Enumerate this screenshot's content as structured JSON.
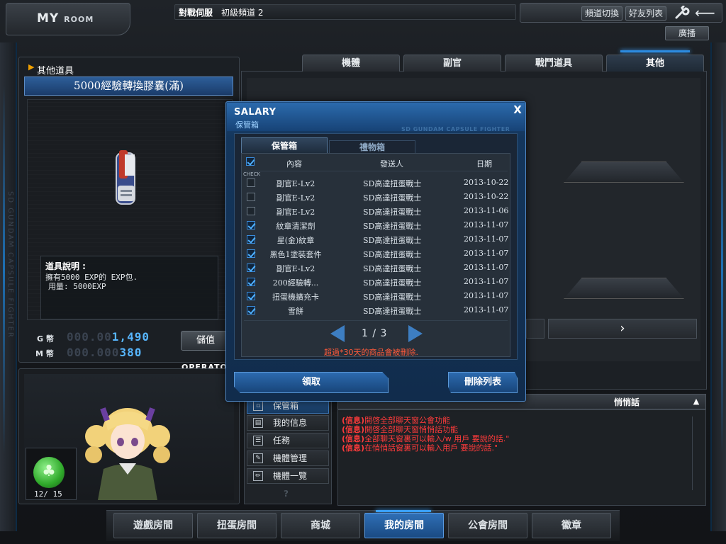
{
  "header": {
    "logo": "MY",
    "logo_small": "ROOM",
    "server": "對戰伺服",
    "channel": "初級頻道 2",
    "channel_switch": "頻道切換",
    "friend_list": "好友列表",
    "broadcast": "廣播"
  },
  "side_text": "SD GUNDAM CAPSULE FIGHTER",
  "left_panel": {
    "section_title": "其他道具",
    "item_name": "5000經驗轉換膠囊(滿)",
    "desc_title": "道具說明 :",
    "desc_line1": "擁有5000 EXP的 EXP包.",
    "desc_line2": "用量: 5000EXP",
    "g_label": "G 幣",
    "m_label": "M 幣",
    "g_dim": "000.00",
    "g_lit": "1,490",
    "m_dim": "000.000",
    "m_lit": "380",
    "recharge": "儲值",
    "operator_label": "OPERATO",
    "stamina": "12/ 15"
  },
  "tabs": [
    "機體",
    "副官",
    "戰鬥道具",
    "其他"
  ],
  "modal": {
    "title": "SALARY",
    "subtitle": "保管箱",
    "watermark": "SD GUNDAM CAPSULE FIGHTER",
    "close": "X",
    "tab_storage": "保管箱",
    "tab_gift": "禮物箱",
    "col_content": "內容",
    "col_sender": "發送人",
    "col_date": "日期",
    "check_label": "CHECK",
    "rows": [
      {
        "content": "副官E-Lv2",
        "sender": "SD高達扭蛋戰士",
        "date": "2013-10-22",
        "checked": false
      },
      {
        "content": "副官E-Lv2",
        "sender": "SD高達扭蛋戰士",
        "date": "2013-10-22",
        "checked": false
      },
      {
        "content": "副官E-Lv2",
        "sender": "SD高達扭蛋戰士",
        "date": "2013-11-06",
        "checked": false
      },
      {
        "content": "紋章清潔劑",
        "sender": "SD高達扭蛋戰士",
        "date": "2013-11-07",
        "checked": true
      },
      {
        "content": "星(金)紋章",
        "sender": "SD高達扭蛋戰士",
        "date": "2013-11-07",
        "checked": true
      },
      {
        "content": "黑色1塗裝套件",
        "sender": "SD高達扭蛋戰士",
        "date": "2013-11-07",
        "checked": true
      },
      {
        "content": "副官E-Lv2",
        "sender": "SD高達扭蛋戰士",
        "date": "2013-11-07",
        "checked": true
      },
      {
        "content": "200經驗轉...",
        "sender": "SD高達扭蛋戰士",
        "date": "2013-11-07",
        "checked": true
      },
      {
        "content": "扭蛋機擴充卡",
        "sender": "SD高達扭蛋戰士",
        "date": "2013-11-07",
        "checked": true
      },
      {
        "content": "雪餅",
        "sender": "SD高達扭蛋戰士",
        "date": "2013-11-07",
        "checked": true
      }
    ],
    "page": "1 / 3",
    "expire_note": "超過*30天的商品會被刪除.",
    "receive_button": "領取",
    "delete_button": "刪除列表"
  },
  "side_menu": [
    "保管箱",
    "我的信息",
    "任務",
    "機體管理",
    "機體一覽"
  ],
  "menu_q": "?",
  "chat": {
    "whisper_tab": "悄悄話",
    "lines": [
      {
        "tag": "(信息)",
        "text": "開啓全部聊天窗公會功能"
      },
      {
        "tag": "(信息)",
        "text": "開啓全部聊天窗悄悄話功能"
      },
      {
        "tag": "(信息)",
        "text": "全部聊天窗裏可以輸入/w 用戶 要說的話.\""
      },
      {
        "tag": "(信息)",
        "text": "在悄悄話窗裏可以輸入用戶 要說的話.\""
      }
    ]
  },
  "bottom_nav": [
    "遊戲房間",
    "扭蛋房間",
    "商城",
    "我的房間",
    "公會房間",
    "徽章"
  ],
  "active_nav": "我的房間",
  "colors": {
    "accent": "#2c8be0",
    "alert": "#ff3b3b",
    "digits": "#57b6ff"
  }
}
